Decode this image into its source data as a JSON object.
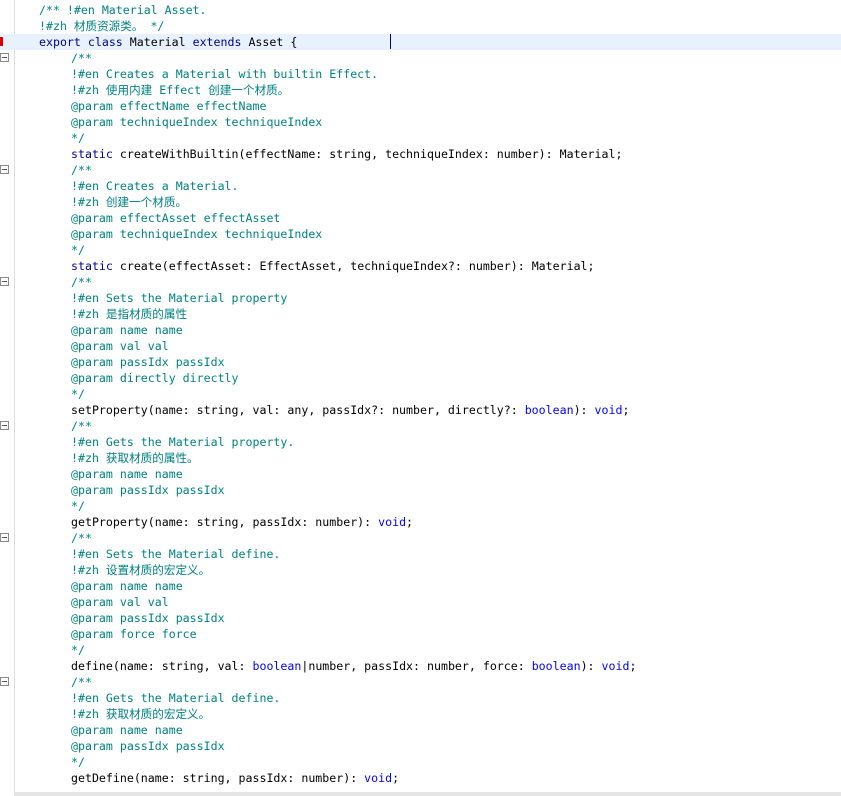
{
  "editor": {
    "lines": [
      {
        "indent": 0,
        "fold": false,
        "marker": false,
        "tokens": [
          {
            "t": "/** !#en Material Asset.",
            "c": "comment"
          }
        ]
      },
      {
        "indent": 0,
        "fold": false,
        "marker": false,
        "tokens": [
          {
            "t": "!#zh 材质资源类。 */",
            "c": "comment"
          }
        ]
      },
      {
        "indent": 0,
        "fold": false,
        "marker": true,
        "current": true,
        "tokens": [
          {
            "t": "export",
            "c": "kw"
          },
          {
            "t": " ",
            "c": "plain"
          },
          {
            "t": "class",
            "c": "kw"
          },
          {
            "t": " Material ",
            "c": "plain"
          },
          {
            "t": "extends",
            "c": "kw"
          },
          {
            "t": " Asset {",
            "c": "plain"
          }
        ]
      },
      {
        "indent": 1,
        "fold": true,
        "marker": false,
        "tokens": [
          {
            "t": "/**",
            "c": "comment"
          }
        ]
      },
      {
        "indent": 1,
        "fold": false,
        "marker": false,
        "tokens": [
          {
            "t": "!#en Creates a Material with builtin Effect.",
            "c": "comment"
          }
        ]
      },
      {
        "indent": 1,
        "fold": false,
        "marker": false,
        "tokens": [
          {
            "t": "!#zh 使用内建 Effect 创建一个材质。",
            "c": "comment"
          }
        ]
      },
      {
        "indent": 1,
        "fold": false,
        "marker": false,
        "tokens": [
          {
            "t": "@param effectName effectName",
            "c": "comment"
          }
        ]
      },
      {
        "indent": 1,
        "fold": false,
        "marker": false,
        "tokens": [
          {
            "t": "@param techniqueIndex techniqueIndex",
            "c": "comment"
          }
        ]
      },
      {
        "indent": 1,
        "fold": false,
        "marker": false,
        "tokens": [
          {
            "t": "*/",
            "c": "comment"
          }
        ]
      },
      {
        "indent": 1,
        "fold": false,
        "marker": false,
        "tokens": [
          {
            "t": "static",
            "c": "kw"
          },
          {
            "t": " createWithBuiltin(effectName: string, techniqueIndex: number): Material;",
            "c": "plain"
          }
        ]
      },
      {
        "indent": 1,
        "fold": true,
        "marker": false,
        "tokens": [
          {
            "t": "/**",
            "c": "comment"
          }
        ]
      },
      {
        "indent": 1,
        "fold": false,
        "marker": false,
        "tokens": [
          {
            "t": "!#en Creates a Material.",
            "c": "comment"
          }
        ]
      },
      {
        "indent": 1,
        "fold": false,
        "marker": false,
        "tokens": [
          {
            "t": "!#zh 创建一个材质。",
            "c": "comment"
          }
        ]
      },
      {
        "indent": 1,
        "fold": false,
        "marker": false,
        "tokens": [
          {
            "t": "@param effectAsset effectAsset",
            "c": "comment"
          }
        ]
      },
      {
        "indent": 1,
        "fold": false,
        "marker": false,
        "tokens": [
          {
            "t": "@param techniqueIndex techniqueIndex",
            "c": "comment"
          }
        ]
      },
      {
        "indent": 1,
        "fold": false,
        "marker": false,
        "tokens": [
          {
            "t": "*/",
            "c": "comment"
          }
        ]
      },
      {
        "indent": 1,
        "fold": false,
        "marker": false,
        "tokens": [
          {
            "t": "static",
            "c": "kw"
          },
          {
            "t": " create(effectAsset: EffectAsset, techniqueIndex?: number): Material;",
            "c": "plain"
          }
        ]
      },
      {
        "indent": 1,
        "fold": true,
        "marker": false,
        "tokens": [
          {
            "t": "/**",
            "c": "comment"
          }
        ]
      },
      {
        "indent": 1,
        "fold": false,
        "marker": false,
        "tokens": [
          {
            "t": "!#en Sets the Material property",
            "c": "comment"
          }
        ]
      },
      {
        "indent": 1,
        "fold": false,
        "marker": false,
        "tokens": [
          {
            "t": "!#zh 是指材质的属性",
            "c": "comment"
          }
        ]
      },
      {
        "indent": 1,
        "fold": false,
        "marker": false,
        "tokens": [
          {
            "t": "@param name name",
            "c": "comment"
          }
        ]
      },
      {
        "indent": 1,
        "fold": false,
        "marker": false,
        "tokens": [
          {
            "t": "@param val val",
            "c": "comment"
          }
        ]
      },
      {
        "indent": 1,
        "fold": false,
        "marker": false,
        "tokens": [
          {
            "t": "@param passIdx passIdx",
            "c": "comment"
          }
        ]
      },
      {
        "indent": 1,
        "fold": false,
        "marker": false,
        "tokens": [
          {
            "t": "@param directly directly",
            "c": "comment"
          }
        ]
      },
      {
        "indent": 1,
        "fold": false,
        "marker": false,
        "tokens": [
          {
            "t": "*/",
            "c": "comment"
          }
        ]
      },
      {
        "indent": 1,
        "fold": false,
        "marker": false,
        "tokens": [
          {
            "t": "setProperty(name: string, val: any, passIdx?: number, directly?: ",
            "c": "plain"
          },
          {
            "t": "boolean",
            "c": "bool"
          },
          {
            "t": "): ",
            "c": "plain"
          },
          {
            "t": "void",
            "c": "bool"
          },
          {
            "t": ";",
            "c": "plain"
          }
        ]
      },
      {
        "indent": 1,
        "fold": true,
        "marker": false,
        "tokens": [
          {
            "t": "/**",
            "c": "comment"
          }
        ]
      },
      {
        "indent": 1,
        "fold": false,
        "marker": false,
        "tokens": [
          {
            "t": "!#en Gets the Material property.",
            "c": "comment"
          }
        ]
      },
      {
        "indent": 1,
        "fold": false,
        "marker": false,
        "tokens": [
          {
            "t": "!#zh 获取材质的属性。",
            "c": "comment"
          }
        ]
      },
      {
        "indent": 1,
        "fold": false,
        "marker": false,
        "tokens": [
          {
            "t": "@param name name",
            "c": "comment"
          }
        ]
      },
      {
        "indent": 1,
        "fold": false,
        "marker": false,
        "tokens": [
          {
            "t": "@param passIdx passIdx",
            "c": "comment"
          }
        ]
      },
      {
        "indent": 1,
        "fold": false,
        "marker": false,
        "tokens": [
          {
            "t": "*/",
            "c": "comment"
          }
        ]
      },
      {
        "indent": 1,
        "fold": false,
        "marker": false,
        "tokens": [
          {
            "t": "getProperty(name: string, passIdx: number): ",
            "c": "plain"
          },
          {
            "t": "void",
            "c": "bool"
          },
          {
            "t": ";",
            "c": "plain"
          }
        ]
      },
      {
        "indent": 1,
        "fold": true,
        "marker": false,
        "tokens": [
          {
            "t": "/**",
            "c": "comment"
          }
        ]
      },
      {
        "indent": 1,
        "fold": false,
        "marker": false,
        "tokens": [
          {
            "t": "!#en Sets the Material define.",
            "c": "comment"
          }
        ]
      },
      {
        "indent": 1,
        "fold": false,
        "marker": false,
        "tokens": [
          {
            "t": "!#zh 设置材质的宏定义。",
            "c": "comment"
          }
        ]
      },
      {
        "indent": 1,
        "fold": false,
        "marker": false,
        "tokens": [
          {
            "t": "@param name name",
            "c": "comment"
          }
        ]
      },
      {
        "indent": 1,
        "fold": false,
        "marker": false,
        "tokens": [
          {
            "t": "@param val val",
            "c": "comment"
          }
        ]
      },
      {
        "indent": 1,
        "fold": false,
        "marker": false,
        "tokens": [
          {
            "t": "@param passIdx passIdx",
            "c": "comment"
          }
        ]
      },
      {
        "indent": 1,
        "fold": false,
        "marker": false,
        "tokens": [
          {
            "t": "@param force force",
            "c": "comment"
          }
        ]
      },
      {
        "indent": 1,
        "fold": false,
        "marker": false,
        "tokens": [
          {
            "t": "*/",
            "c": "comment"
          }
        ]
      },
      {
        "indent": 1,
        "fold": false,
        "marker": false,
        "tokens": [
          {
            "t": "define(name: string, val: ",
            "c": "plain"
          },
          {
            "t": "boolean",
            "c": "bool"
          },
          {
            "t": "|number, passIdx: number, force: ",
            "c": "plain"
          },
          {
            "t": "boolean",
            "c": "bool"
          },
          {
            "t": "): ",
            "c": "plain"
          },
          {
            "t": "void",
            "c": "bool"
          },
          {
            "t": ";",
            "c": "plain"
          }
        ]
      },
      {
        "indent": 1,
        "fold": true,
        "marker": false,
        "tokens": [
          {
            "t": "/**",
            "c": "comment"
          }
        ]
      },
      {
        "indent": 1,
        "fold": false,
        "marker": false,
        "tokens": [
          {
            "t": "!#en Gets the Material define.",
            "c": "comment"
          }
        ]
      },
      {
        "indent": 1,
        "fold": false,
        "marker": false,
        "tokens": [
          {
            "t": "!#zh 获取材质的宏定义。",
            "c": "comment"
          }
        ]
      },
      {
        "indent": 1,
        "fold": false,
        "marker": false,
        "tokens": [
          {
            "t": "@param name name",
            "c": "comment"
          }
        ]
      },
      {
        "indent": 1,
        "fold": false,
        "marker": false,
        "tokens": [
          {
            "t": "@param passIdx passIdx",
            "c": "comment"
          }
        ]
      },
      {
        "indent": 1,
        "fold": false,
        "marker": false,
        "tokens": [
          {
            "t": "*/",
            "c": "comment"
          }
        ]
      },
      {
        "indent": 1,
        "fold": false,
        "marker": false,
        "tokens": [
          {
            "t": "getDefine(name: string, passIdx: number): ",
            "c": "plain"
          },
          {
            "t": "void",
            "c": "bool"
          },
          {
            "t": ";",
            "c": "plain"
          }
        ]
      }
    ]
  }
}
